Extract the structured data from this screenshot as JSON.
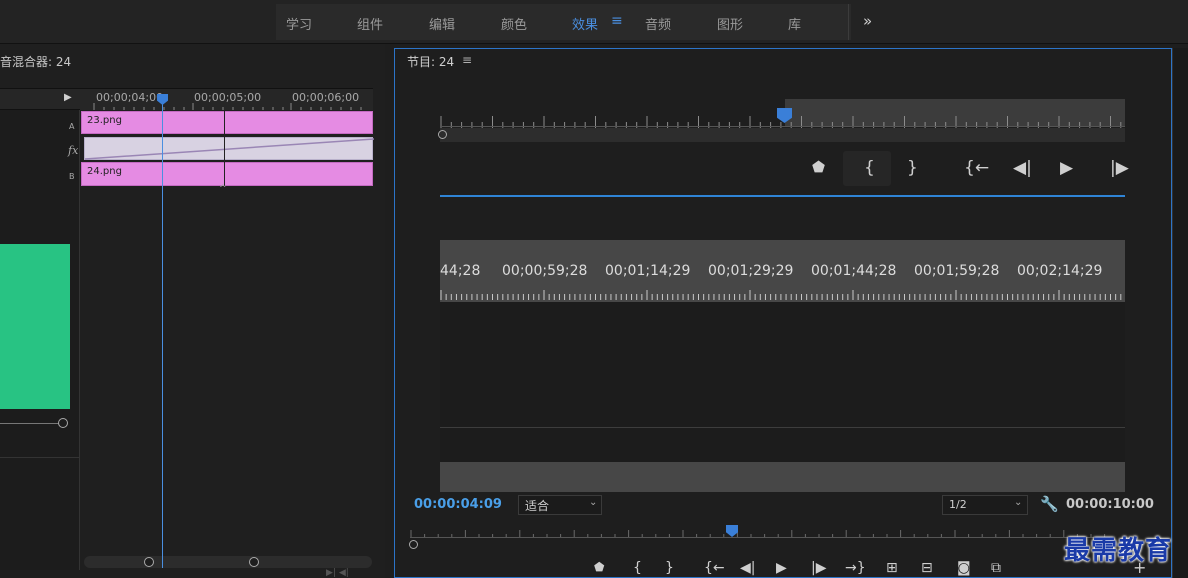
{
  "workspaces": {
    "items": [
      {
        "label": "学习"
      },
      {
        "label": "组件"
      },
      {
        "label": "编辑"
      },
      {
        "label": "颜色"
      },
      {
        "label": "效果"
      },
      {
        "label": "音频"
      },
      {
        "label": "图形"
      },
      {
        "label": "库"
      }
    ],
    "active": "效果",
    "overflow": "»"
  },
  "left_panel": {
    "title": "音混合器: 24",
    "ruler_times": [
      "00;00;04;00",
      "00;00;05;00",
      "00;00;06;00"
    ],
    "track_labels": [
      "A",
      "fx",
      "B"
    ],
    "clip_a": "23.png",
    "clip_b": "24.png",
    "green_block_color": "#28c383"
  },
  "program_monitor": {
    "title": "节目: 24",
    "inner_timeline_codes": [
      "44;28",
      "00;00;59;28",
      "00;01;14;29",
      "00;01;29;29",
      "00;01;44;28",
      "00;01;59;28",
      "00;02;14;29"
    ],
    "current_timecode": "00:00:04:09",
    "fit_label": "适合",
    "resolution": "1/2",
    "duration": "00:00:10:00",
    "accent_color": "#4a9fe8"
  },
  "watermark": "最需教育"
}
